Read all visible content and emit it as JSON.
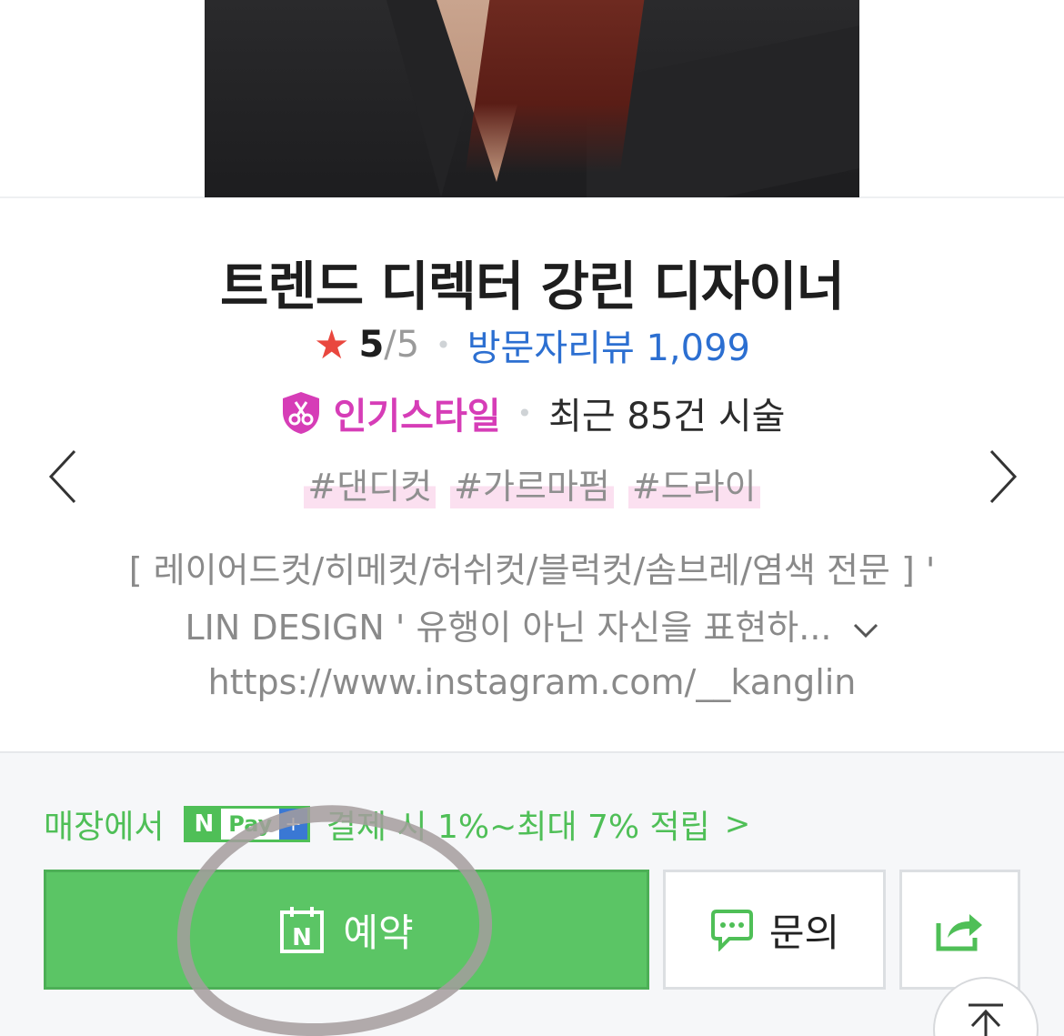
{
  "shop": {
    "title": "트렌드 디렉터 강린 디자이너",
    "rating_score": "5",
    "rating_total": "/5",
    "review_label": "방문자리뷰 1,099",
    "popular_label": "인기스타일",
    "recent_label": "최근 85건 시술",
    "tags": [
      "#댄디컷",
      "#가르마펌",
      "#드라이"
    ],
    "description_line1": "[ 레이어드컷/히메컷/허쉬컷/블럭컷/솜브레/염색 전문 ] '",
    "description_line2": "LIN DESIGN ' 유행이 아닌 자신을 표현하...",
    "link": "https://www.instagram.com/__kanglin"
  },
  "npay": {
    "prefix": "매장에서",
    "badge_n": "N",
    "badge_pay": "Pay",
    "badge_plus": "+",
    "text": "결제 시 1%~최대 7% 적립",
    "chevron": ">"
  },
  "actions": {
    "reserve_label": "예약",
    "inquiry_label": "문의"
  },
  "colors": {
    "accent_green": "#5bc565",
    "review_blue": "#2c6fd1",
    "popular_pink": "#d63db7",
    "star_red": "#e9473e"
  },
  "icons": [
    "star-icon",
    "scissors-shield-icon",
    "chevron-left-icon",
    "chevron-right-icon",
    "chevron-down-icon",
    "calendar-n-icon",
    "chat-bubble-icon",
    "share-icon",
    "arrow-up-top-icon"
  ]
}
